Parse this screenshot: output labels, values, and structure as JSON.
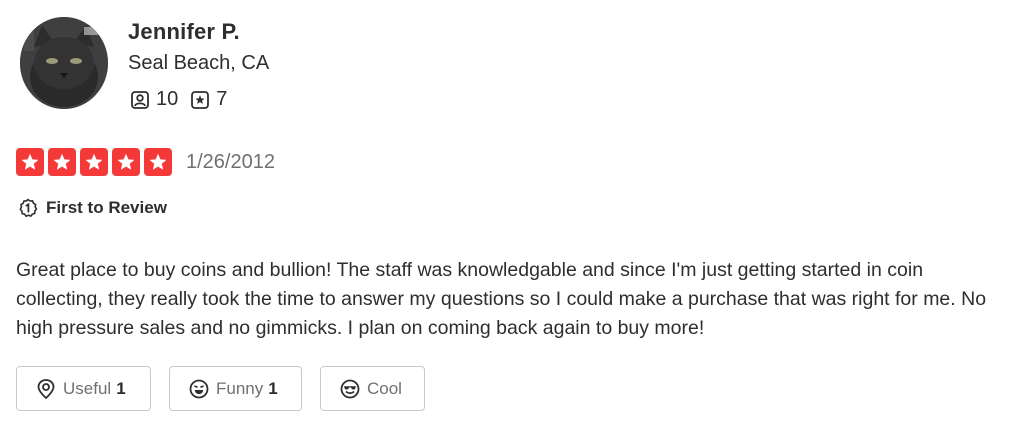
{
  "user": {
    "name": "Jennifer P.",
    "location": "Seal Beach, CA",
    "friends_count": "10",
    "reviews_count": "7",
    "friends_icon": "friends-icon",
    "reviews_icon": "review-star-icon"
  },
  "review": {
    "rating": 5,
    "max_rating": 5,
    "date": "1/26/2012",
    "badge_label": "First to Review",
    "text": "Great place to buy coins and bullion! The staff was knowledgable and since I'm just getting started in coin collecting, they really took the time to answer my questions so I could make a purchase that was right for me. No high pressure sales and no gimmicks. I plan on coming back again to buy more!"
  },
  "reactions": {
    "useful_label": "Useful",
    "useful_count": "1",
    "funny_label": "Funny",
    "funny_count": "1",
    "cool_label": "Cool"
  },
  "colors": {
    "star_red": "#f43939",
    "text_dark": "#2d2e2f",
    "text_muted": "#6e7072",
    "border": "#c8c9ca"
  }
}
